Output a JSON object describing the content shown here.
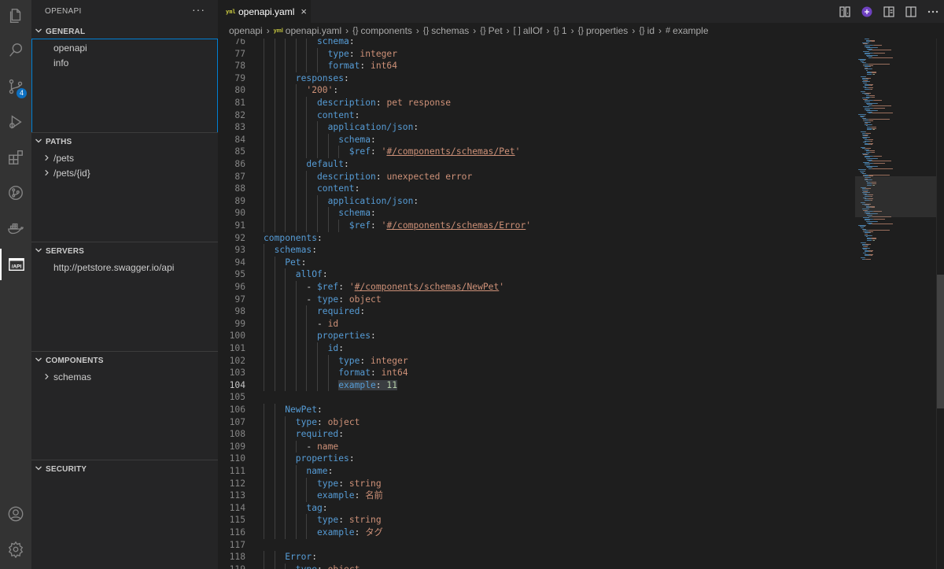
{
  "activity_bar": {
    "items": [
      {
        "name": "explorer-icon"
      },
      {
        "name": "search-icon"
      },
      {
        "name": "source-control-icon",
        "badge": "4"
      },
      {
        "name": "run-debug-icon"
      },
      {
        "name": "extensions-icon"
      },
      {
        "name": "git-graph-icon"
      },
      {
        "name": "docker-icon"
      },
      {
        "name": "openapi-icon"
      }
    ],
    "bottom": [
      {
        "name": "account-icon"
      },
      {
        "name": "settings-gear-icon"
      }
    ]
  },
  "sidebar": {
    "title": "OPENAPI",
    "more": "···",
    "sections": {
      "general": {
        "label": "GENERAL",
        "items": [
          "openapi",
          "info"
        ]
      },
      "paths": {
        "label": "PATHS",
        "items": [
          "/pets",
          "/pets/{id}"
        ]
      },
      "servers": {
        "label": "SERVERS",
        "items": [
          "http://petstore.swagger.io/api"
        ]
      },
      "components": {
        "label": "COMPONENTS",
        "items": [
          "schemas"
        ]
      },
      "security": {
        "label": "SECURITY",
        "items": []
      }
    }
  },
  "tab": {
    "label": "openapi.yaml",
    "icon_text": "yml",
    "close": "×"
  },
  "breadcrumb": {
    "items": [
      "openapi",
      "openapi.yaml",
      "components",
      "schemas",
      "Pet",
      "allOf",
      "1",
      "properties",
      "id",
      "example"
    ]
  },
  "editor": {
    "current_line": 104,
    "lines": [
      {
        "n": "76",
        "indent": 5,
        "parts": [
          [
            "k",
            "schema"
          ],
          [
            "p",
            ":"
          ]
        ]
      },
      {
        "n": "77",
        "indent": 6,
        "parts": [
          [
            "k",
            "type"
          ],
          [
            "p",
            ": "
          ],
          [
            "s",
            "integer"
          ]
        ]
      },
      {
        "n": "78",
        "indent": 6,
        "parts": [
          [
            "k",
            "format"
          ],
          [
            "p",
            ": "
          ],
          [
            "s",
            "int64"
          ]
        ]
      },
      {
        "n": "79",
        "indent": 3,
        "parts": [
          [
            "k",
            "responses"
          ],
          [
            "p",
            ":"
          ]
        ]
      },
      {
        "n": "80",
        "indent": 4,
        "parts": [
          [
            "s",
            "'200'"
          ],
          [
            "p",
            ":"
          ]
        ]
      },
      {
        "n": "81",
        "indent": 5,
        "parts": [
          [
            "k",
            "description"
          ],
          [
            "p",
            ": "
          ],
          [
            "s",
            "pet response"
          ]
        ]
      },
      {
        "n": "82",
        "indent": 5,
        "parts": [
          [
            "k",
            "content"
          ],
          [
            "p",
            ":"
          ]
        ]
      },
      {
        "n": "83",
        "indent": 6,
        "parts": [
          [
            "k",
            "application/json"
          ],
          [
            "p",
            ":"
          ]
        ]
      },
      {
        "n": "84",
        "indent": 7,
        "parts": [
          [
            "k",
            "schema"
          ],
          [
            "p",
            ":"
          ]
        ]
      },
      {
        "n": "85",
        "indent": 8,
        "parts": [
          [
            "k",
            "$ref"
          ],
          [
            "p",
            ": "
          ],
          [
            "s",
            "'"
          ],
          [
            "ref",
            "#/components/schemas/Pet"
          ],
          [
            "s",
            "'"
          ]
        ]
      },
      {
        "n": "86",
        "indent": 4,
        "parts": [
          [
            "k",
            "default"
          ],
          [
            "p",
            ":"
          ]
        ]
      },
      {
        "n": "87",
        "indent": 5,
        "parts": [
          [
            "k",
            "description"
          ],
          [
            "p",
            ": "
          ],
          [
            "s",
            "unexpected error"
          ]
        ]
      },
      {
        "n": "88",
        "indent": 5,
        "parts": [
          [
            "k",
            "content"
          ],
          [
            "p",
            ":"
          ]
        ]
      },
      {
        "n": "89",
        "indent": 6,
        "parts": [
          [
            "k",
            "application/json"
          ],
          [
            "p",
            ":"
          ]
        ]
      },
      {
        "n": "90",
        "indent": 7,
        "parts": [
          [
            "k",
            "schema"
          ],
          [
            "p",
            ":"
          ]
        ]
      },
      {
        "n": "91",
        "indent": 8,
        "parts": [
          [
            "k",
            "$ref"
          ],
          [
            "p",
            ": "
          ],
          [
            "s",
            "'"
          ],
          [
            "ref",
            "#/components/schemas/Error"
          ],
          [
            "s",
            "'"
          ]
        ]
      },
      {
        "n": "92",
        "indent": 0,
        "parts": [
          [
            "k",
            "components"
          ],
          [
            "p",
            ":"
          ]
        ]
      },
      {
        "n": "93",
        "indent": 1,
        "parts": [
          [
            "k",
            "schemas"
          ],
          [
            "p",
            ":"
          ]
        ]
      },
      {
        "n": "94",
        "indent": 2,
        "parts": [
          [
            "k",
            "Pet"
          ],
          [
            "p",
            ":"
          ]
        ]
      },
      {
        "n": "95",
        "indent": 3,
        "parts": [
          [
            "k",
            "allOf"
          ],
          [
            "p",
            ":"
          ]
        ]
      },
      {
        "n": "96",
        "indent": 4,
        "parts": [
          [
            "p",
            "- "
          ],
          [
            "k",
            "$ref"
          ],
          [
            "p",
            ": "
          ],
          [
            "s",
            "'"
          ],
          [
            "ref",
            "#/components/schemas/NewPet"
          ],
          [
            "s",
            "'"
          ]
        ]
      },
      {
        "n": "97",
        "indent": 4,
        "parts": [
          [
            "p",
            "- "
          ],
          [
            "k",
            "type"
          ],
          [
            "p",
            ": "
          ],
          [
            "s",
            "object"
          ]
        ]
      },
      {
        "n": "98",
        "indent": 5,
        "parts": [
          [
            "k",
            "required"
          ],
          [
            "p",
            ":"
          ]
        ]
      },
      {
        "n": "99",
        "indent": 5,
        "parts": [
          [
            "p",
            "- "
          ],
          [
            "s",
            "id"
          ]
        ]
      },
      {
        "n": "100",
        "indent": 5,
        "parts": [
          [
            "k",
            "properties"
          ],
          [
            "p",
            ":"
          ]
        ]
      },
      {
        "n": "101",
        "indent": 6,
        "parts": [
          [
            "k",
            "id"
          ],
          [
            "p",
            ":"
          ]
        ]
      },
      {
        "n": "102",
        "indent": 7,
        "parts": [
          [
            "k",
            "type"
          ],
          [
            "p",
            ": "
          ],
          [
            "s",
            "integer"
          ]
        ]
      },
      {
        "n": "103",
        "indent": 7,
        "parts": [
          [
            "k",
            "format"
          ],
          [
            "p",
            ": "
          ],
          [
            "s",
            "int64"
          ]
        ]
      },
      {
        "n": "104",
        "indent": 7,
        "parts": [
          [
            "k",
            "example"
          ],
          [
            "p",
            ": "
          ],
          [
            "n",
            "11"
          ]
        ],
        "highlight": true
      },
      {
        "n": "105",
        "indent": 0,
        "parts": []
      },
      {
        "n": "106",
        "indent": 2,
        "parts": [
          [
            "k",
            "NewPet"
          ],
          [
            "p",
            ":"
          ]
        ]
      },
      {
        "n": "107",
        "indent": 3,
        "parts": [
          [
            "k",
            "type"
          ],
          [
            "p",
            ": "
          ],
          [
            "s",
            "object"
          ]
        ]
      },
      {
        "n": "108",
        "indent": 3,
        "parts": [
          [
            "k",
            "required"
          ],
          [
            "p",
            ":"
          ]
        ]
      },
      {
        "n": "109",
        "indent": 4,
        "parts": [
          [
            "p",
            "- "
          ],
          [
            "s",
            "name"
          ]
        ]
      },
      {
        "n": "110",
        "indent": 3,
        "parts": [
          [
            "k",
            "properties"
          ],
          [
            "p",
            ":"
          ]
        ]
      },
      {
        "n": "111",
        "indent": 4,
        "parts": [
          [
            "k",
            "name"
          ],
          [
            "p",
            ":"
          ]
        ]
      },
      {
        "n": "112",
        "indent": 5,
        "parts": [
          [
            "k",
            "type"
          ],
          [
            "p",
            ": "
          ],
          [
            "s",
            "string"
          ]
        ]
      },
      {
        "n": "113",
        "indent": 5,
        "parts": [
          [
            "k",
            "example"
          ],
          [
            "p",
            ": "
          ],
          [
            "s",
            "名前"
          ]
        ]
      },
      {
        "n": "114",
        "indent": 4,
        "parts": [
          [
            "k",
            "tag"
          ],
          [
            "p",
            ":"
          ]
        ]
      },
      {
        "n": "115",
        "indent": 5,
        "parts": [
          [
            "k",
            "type"
          ],
          [
            "p",
            ": "
          ],
          [
            "s",
            "string"
          ]
        ]
      },
      {
        "n": "116",
        "indent": 5,
        "parts": [
          [
            "k",
            "example"
          ],
          [
            "p",
            ": "
          ],
          [
            "s",
            "タグ"
          ]
        ]
      },
      {
        "n": "117",
        "indent": 0,
        "parts": []
      },
      {
        "n": "118",
        "indent": 2,
        "parts": [
          [
            "k",
            "Error"
          ],
          [
            "p",
            ":"
          ]
        ]
      },
      {
        "n": "119",
        "indent": 3,
        "parts": [
          [
            "k",
            "type"
          ],
          [
            "p",
            ": "
          ],
          [
            "s",
            "object"
          ]
        ]
      }
    ]
  },
  "colors": {
    "keyword": "#569cd6",
    "string": "#ce9178",
    "number": "#b5cea8",
    "accent": "#007fd4",
    "badge": "#0e70c0"
  }
}
